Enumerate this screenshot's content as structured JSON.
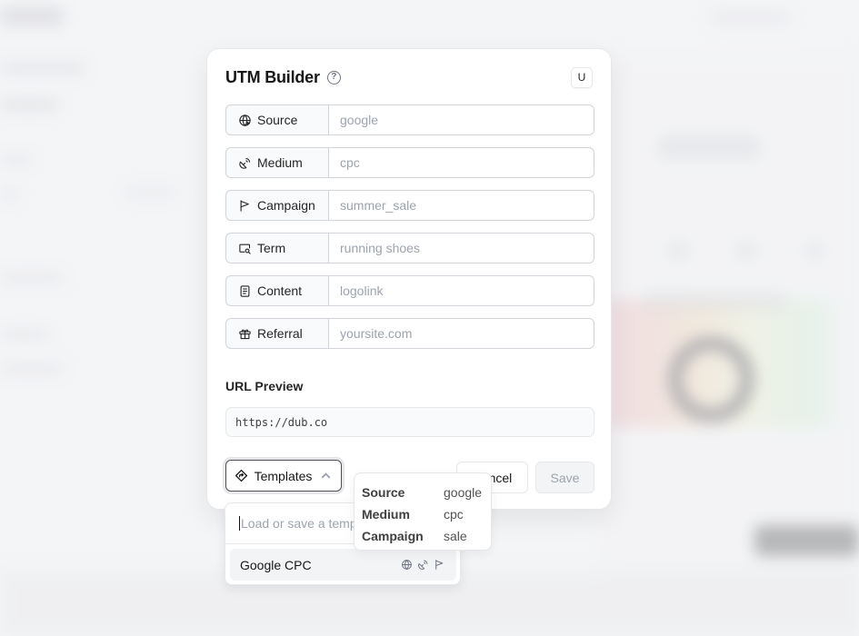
{
  "modal": {
    "title": "UTM Builder",
    "help_icon": "help-circle-icon",
    "shortcut_key": "U",
    "fields": [
      {
        "label": "Source",
        "icon": "globe-icon",
        "value": "",
        "placeholder": "google"
      },
      {
        "label": "Medium",
        "icon": "satellite-dish-icon",
        "value": "",
        "placeholder": "cpc"
      },
      {
        "label": "Campaign",
        "icon": "flag-icon",
        "value": "",
        "placeholder": "summer_sale"
      },
      {
        "label": "Term",
        "icon": "search-window-icon",
        "value": "",
        "placeholder": "running shoes"
      },
      {
        "label": "Content",
        "icon": "file-text-icon",
        "value": "",
        "placeholder": "logolink"
      },
      {
        "label": "Referral",
        "icon": "gift-icon",
        "value": "",
        "placeholder": "yoursite.com"
      }
    ],
    "preview": {
      "label": "URL Preview",
      "url": "https://dub.co"
    },
    "buttons": {
      "templates": "Templates",
      "cancel": "Cancel",
      "save": "Save"
    }
  },
  "templates_dropdown": {
    "search_placeholder": "Load or save a template...",
    "items": [
      {
        "name": "Google CPC",
        "icons": [
          "globe-icon",
          "satellite-dish-icon",
          "flag-icon"
        ]
      }
    ]
  },
  "template_tooltip": {
    "rows": [
      {
        "key": "Source",
        "value": "google"
      },
      {
        "key": "Medium",
        "value": "cpc"
      },
      {
        "key": "Campaign",
        "value": "sale"
      }
    ]
  }
}
